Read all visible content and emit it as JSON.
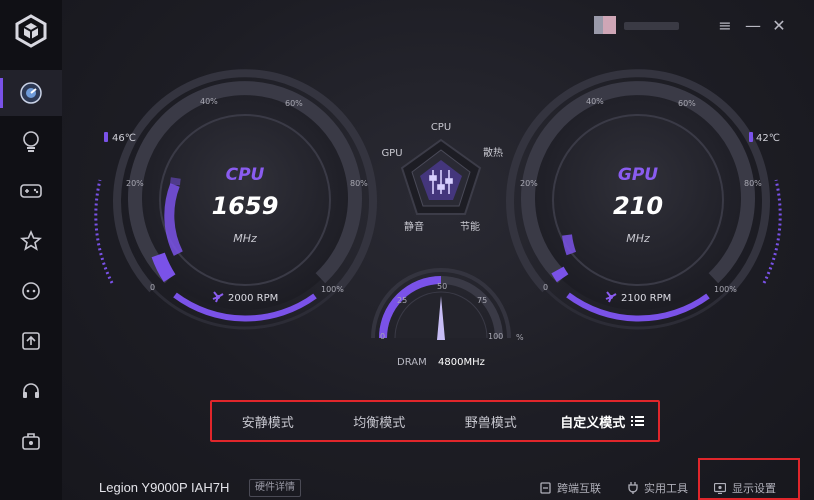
{
  "colors": {
    "accent": "#7a52e8",
    "highlight": "#e0262b",
    "text": "#c8c8d0"
  },
  "sidebar": {
    "items": [
      {
        "icon": "dashboard-icon",
        "active": true
      },
      {
        "icon": "lightbulb-icon"
      },
      {
        "icon": "gamepad-icon"
      },
      {
        "icon": "star-icon"
      },
      {
        "icon": "chat-icon"
      },
      {
        "icon": "upload-icon"
      },
      {
        "icon": "headset-icon"
      },
      {
        "icon": "toolbox-icon"
      }
    ]
  },
  "cpu": {
    "title": "CPU",
    "freq": "1659",
    "unit": "MHz",
    "temp": "46℃",
    "fan": "2000 RPM",
    "ticks": {
      "p0": "0",
      "p20": "20%",
      "p40": "40%",
      "p60": "60%",
      "p80": "80%",
      "p100": "100%"
    }
  },
  "gpu": {
    "title": "GPU",
    "freq": "210",
    "unit": "MHz",
    "temp": "42℃",
    "fan": "2100 RPM",
    "ticks": {
      "p0": "0",
      "p20": "20%",
      "p40": "40%",
      "p60": "60%",
      "p80": "80%",
      "p100": "100%"
    }
  },
  "radar": {
    "top": "CPU",
    "left": "GPU",
    "right": "散热",
    "bottom_left": "静音",
    "bottom_right": "节能"
  },
  "dram": {
    "label": "DRAM",
    "value": "4800MHz",
    "ticks": {
      "t0": "0",
      "t25": "25",
      "t50": "50",
      "t75": "75",
      "t100": "100"
    },
    "unit": "%",
    "needle_percent": 50
  },
  "modes": [
    {
      "label": "安静模式",
      "active": false
    },
    {
      "label": "均衡模式",
      "active": false
    },
    {
      "label": "野兽模式",
      "active": false
    },
    {
      "label": "自定义模式",
      "active": true
    }
  ],
  "bottom": {
    "model": "Legion Y9000P IAH7H",
    "hw_details": "硬件详情",
    "cross_device": "跨端互联",
    "tools": "实用工具",
    "display": "显示设置"
  }
}
